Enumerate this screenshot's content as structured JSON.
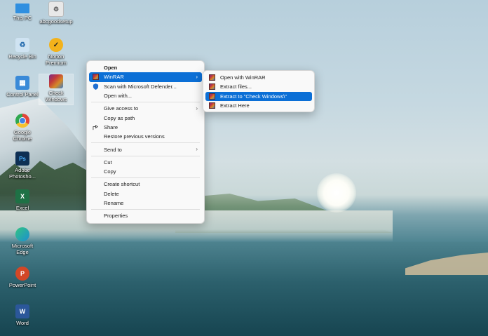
{
  "desktop": {
    "icons": [
      {
        "label": "This PC",
        "icon": "monitor-icon",
        "color": "#2f8fe0"
      },
      {
        "label": "Recycle Bin",
        "icon": "recycle-bin-icon",
        "color": "#cfe3f2"
      },
      {
        "label": "Control Panel",
        "icon": "control-panel-icon",
        "color": "#3a8ad8"
      },
      {
        "label": "Google Chrome",
        "icon": "chrome-icon",
        "color": "#e3453a"
      },
      {
        "label": "Adobe Photosho...",
        "icon": "photoshop-icon",
        "color": "#0e2f54"
      },
      {
        "label": "Excel",
        "icon": "excel-icon",
        "color": "#1e7145"
      },
      {
        "label": "Microsoft Edge",
        "icon": "edge-icon",
        "color": "#1b8fd1"
      },
      {
        "label": "PowerPoint",
        "icon": "powerpoint-icon",
        "color": "#d24726"
      },
      {
        "label": "Word",
        "icon": "word-icon",
        "color": "#2b579a"
      },
      {
        "label": "abcgoodsetup",
        "icon": "shortcut-file-icon",
        "color": "#e8e8e8"
      },
      {
        "label": "Norton Premium",
        "icon": "norton-icon",
        "color": "#f3b21b"
      },
      {
        "label": "Check Windows",
        "icon": "winrar-archive-icon",
        "color": "#a8326e"
      }
    ]
  },
  "context_menu": {
    "items": [
      {
        "label": "Open"
      },
      {
        "label": "WinRAR"
      },
      {
        "label": "Scan with Microsoft Defender..."
      },
      {
        "label": "Open with..."
      },
      {
        "label": "Give access to"
      },
      {
        "label": "Copy as path"
      },
      {
        "label": "Share"
      },
      {
        "label": "Restore previous versions"
      },
      {
        "label": "Send to"
      },
      {
        "label": "Cut"
      },
      {
        "label": "Copy"
      },
      {
        "label": "Create shortcut"
      },
      {
        "label": "Delete"
      },
      {
        "label": "Rename"
      },
      {
        "label": "Properties"
      }
    ]
  },
  "winrar_submenu": {
    "items": [
      {
        "label": "Open with WinRAR"
      },
      {
        "label": "Extract files..."
      },
      {
        "label": "Extract to \"Check Windows\\\""
      },
      {
        "label": "Extract Here"
      }
    ]
  },
  "colors": {
    "highlight": "#0b6fd6",
    "menu_bg": "#f9f9f9"
  }
}
